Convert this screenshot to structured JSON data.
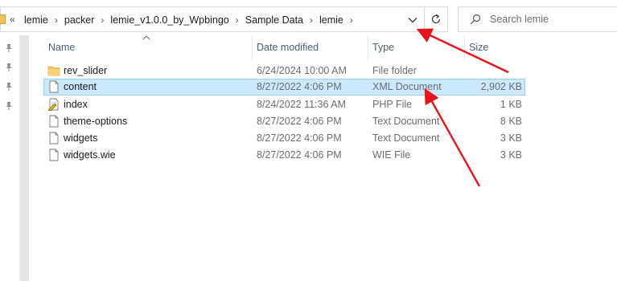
{
  "address_bar": {
    "overflow_label": "«",
    "breadcrumbs": [
      "lemie",
      "packer",
      "lemie_v1.0.0_by_Wpbingo",
      "Sample Data",
      "lemie"
    ],
    "separator": "›"
  },
  "search": {
    "placeholder": "Search lemie"
  },
  "columns": {
    "name": "Name",
    "date_modified": "Date modified",
    "type": "Type",
    "size": "Size"
  },
  "files": [
    {
      "name": "rev_slider",
      "date": "6/24/2024 10:00 AM",
      "type": "File folder",
      "size": "",
      "icon": "folder-icon",
      "selected": false
    },
    {
      "name": "content",
      "date": "8/27/2022 4:06 PM",
      "type": "XML Document",
      "size": "2,902 KB",
      "icon": "xml-document-icon",
      "selected": true
    },
    {
      "name": "index",
      "date": "8/24/2022 11:36 AM",
      "type": "PHP File",
      "size": "1 KB",
      "icon": "php-file-icon",
      "selected": false
    },
    {
      "name": "theme-options",
      "date": "8/27/2022 4:06 PM",
      "type": "Text Document",
      "size": "8 KB",
      "icon": "text-document-icon",
      "selected": false
    },
    {
      "name": "widgets",
      "date": "8/27/2022 4:06 PM",
      "type": "Text Document",
      "size": "3 KB",
      "icon": "text-document-icon",
      "selected": false
    },
    {
      "name": "widgets.wie",
      "date": "8/27/2022 4:06 PM",
      "type": "WIE File",
      "size": "3 KB",
      "icon": "wie-file-icon",
      "selected": false
    }
  ],
  "colors": {
    "selection": "#cce8ff",
    "selection_border": "#99d1ff",
    "annotation_arrow": "#e8141b",
    "header_text": "#4c6079",
    "folder": "#f2c55c"
  }
}
